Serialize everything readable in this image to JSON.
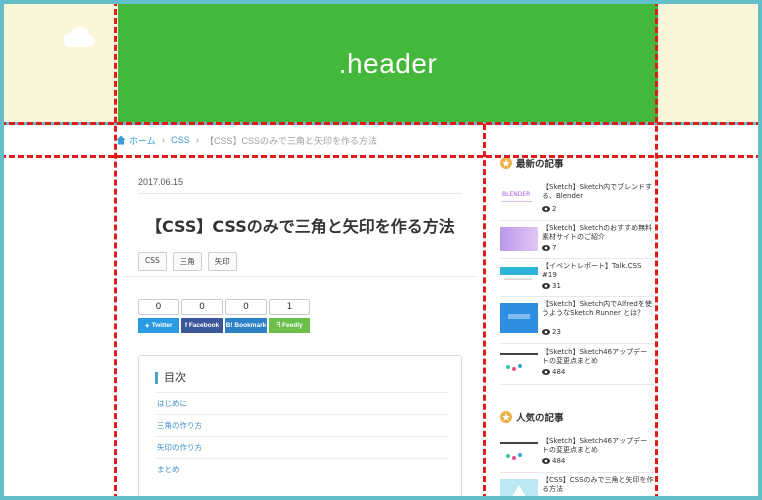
{
  "header": {
    "label": ".header"
  },
  "breadcrumb": {
    "home": "ホーム",
    "category": "CSS",
    "current": "【CSS】CSSのみで三角と矢印を作る方法"
  },
  "article": {
    "date": "2017.06.15",
    "title": "【CSS】CSSのみで三角と矢印を作る方法",
    "tags": [
      "CSS",
      "三角",
      "矢印"
    ],
    "share": [
      {
        "count": "0",
        "label": "Twitter",
        "color": "#2b9ae4"
      },
      {
        "count": "0",
        "label": "Facebook",
        "color": "#3a589b"
      },
      {
        "count": "0",
        "label": "B! Bookmark",
        "color": "#2c81c7"
      },
      {
        "count": "1",
        "label": "Feedly",
        "color": "#6cc04a"
      }
    ],
    "toc": {
      "title": "目次",
      "items": [
        "はじめに",
        "三角の作り方",
        "矢印の作り方",
        "まとめ"
      ]
    }
  },
  "sidebar": {
    "recent_heading": "最新の記事",
    "recent": [
      {
        "title": "【Sketch】Sketch内でブレンドする、Blender",
        "views": "2",
        "thumb_color": "#ffffff"
      },
      {
        "title": "【Sketch】Sketchのおすすめ無料素材サイトのご紹介",
        "views": "7",
        "thumb_color": "#c9a8ea"
      },
      {
        "title": "【イベントレポート】Talk.CSS #19",
        "views": "31",
        "thumb_color": "#2fb4d9"
      },
      {
        "title": "【Sketch】Sketch内でAlfredを使うようなSketch Runner とは？",
        "views": "23",
        "thumb_color": "#2d8fe2"
      },
      {
        "title": "【Sketch】Sketch46アップデートの変更点まとめ",
        "views": "484",
        "thumb_color": "#ffffff"
      }
    ],
    "popular_heading": "人気の記事",
    "popular": [
      {
        "title": "【Sketch】Sketch46アップデートの変更点まとめ",
        "views": "484",
        "thumb_color": "#ffffff"
      },
      {
        "title": "【CSS】CSSのみで三角と矢印を作る方法",
        "views": "",
        "thumb_color": "#7fd3e6"
      }
    ]
  },
  "colors": {
    "frame": "#62bfc9",
    "band": "#fbf5da",
    "header": "#44b83a",
    "guide": "#e01b1b"
  }
}
